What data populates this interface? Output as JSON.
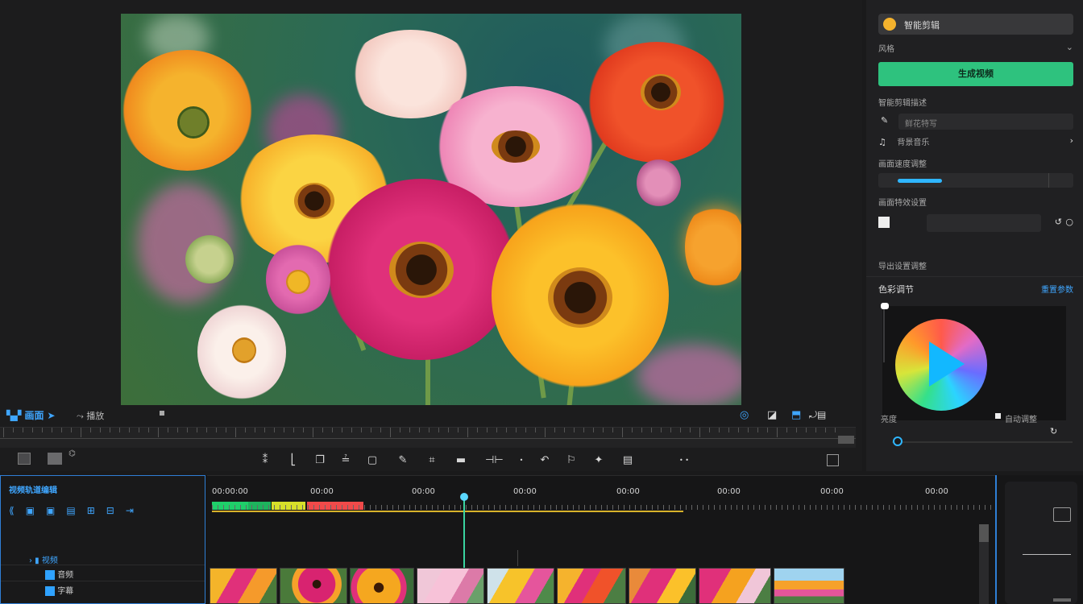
{
  "app": {
    "accent": "#2ec27e",
    "highlight": "#3fa6ff"
  },
  "transport": {
    "left_label": "画面",
    "left_label2": "播放",
    "right_icons": [
      "refresh-icon",
      "crop-icon",
      "fullscreen-icon",
      "ratio-icon"
    ]
  },
  "inspector": {
    "header_title": "智能剪辑",
    "row1_label": "风格",
    "row1_value": "",
    "primary_button": "生成视频",
    "section1": "智能剪辑描述",
    "desc_field": "鲜花特写",
    "row_music": "背景音乐",
    "section_speed": "画面速度调整",
    "section_effect": "画面特效设置",
    "effect_field": "",
    "section_export": "导出设置调整",
    "color_title": "色彩调节",
    "color_link": "重置参数",
    "color_label_left": "亮度",
    "color_label_right": "自动调整"
  },
  "timeline": {
    "track_title": "视频轨道编辑",
    "track_items": [
      "视频",
      "音频",
      "字幕"
    ],
    "time_labels": [
      "00:00:00",
      "00:00",
      "00:00",
      "00:00",
      "00:00",
      "00:00",
      "00:00",
      "00:00"
    ],
    "clip_count": 9
  }
}
